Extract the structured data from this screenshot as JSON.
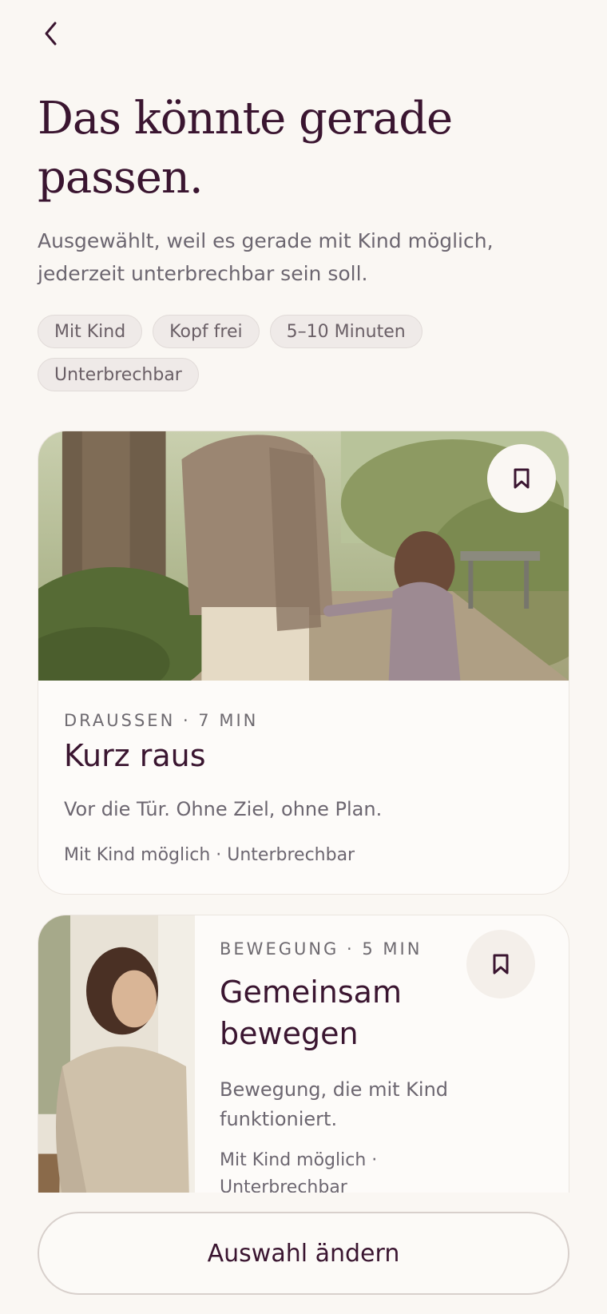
{
  "header": {
    "back_icon": "chevron-left-icon",
    "title": "Das könnte gerade passen.",
    "subtitle": "Ausgewählt, weil es gerade mit Kind möglich, jederzeit unterbrechbar sein soll."
  },
  "chips": [
    "Mit Kind",
    "Kopf frei",
    "5–10 Minuten",
    "Unterbrechbar"
  ],
  "cards": [
    {
      "meta": "DRAUSSEN · 7 MIN",
      "title": "Kurz raus",
      "description": "Vor die Tür. Ohne Ziel, ohne Plan.",
      "tags": "Mit Kind möglich · Unterbrechbar",
      "bookmark_icon": "bookmark-icon"
    },
    {
      "meta": "BEWEGUNG · 5 MIN",
      "title": "Gemeinsam bewegen",
      "description": "Bewegung, die mit Kind funktioniert.",
      "tags": "Mit Kind möglich · Unterbrechbar",
      "bookmark_icon": "bookmark-icon"
    }
  ],
  "cta": {
    "label": "Auswahl ändern"
  },
  "colors": {
    "background": "#faf7f3",
    "accent": "#3a1530",
    "muted_text": "#6c6670",
    "chip_bg": "#efeae8"
  }
}
